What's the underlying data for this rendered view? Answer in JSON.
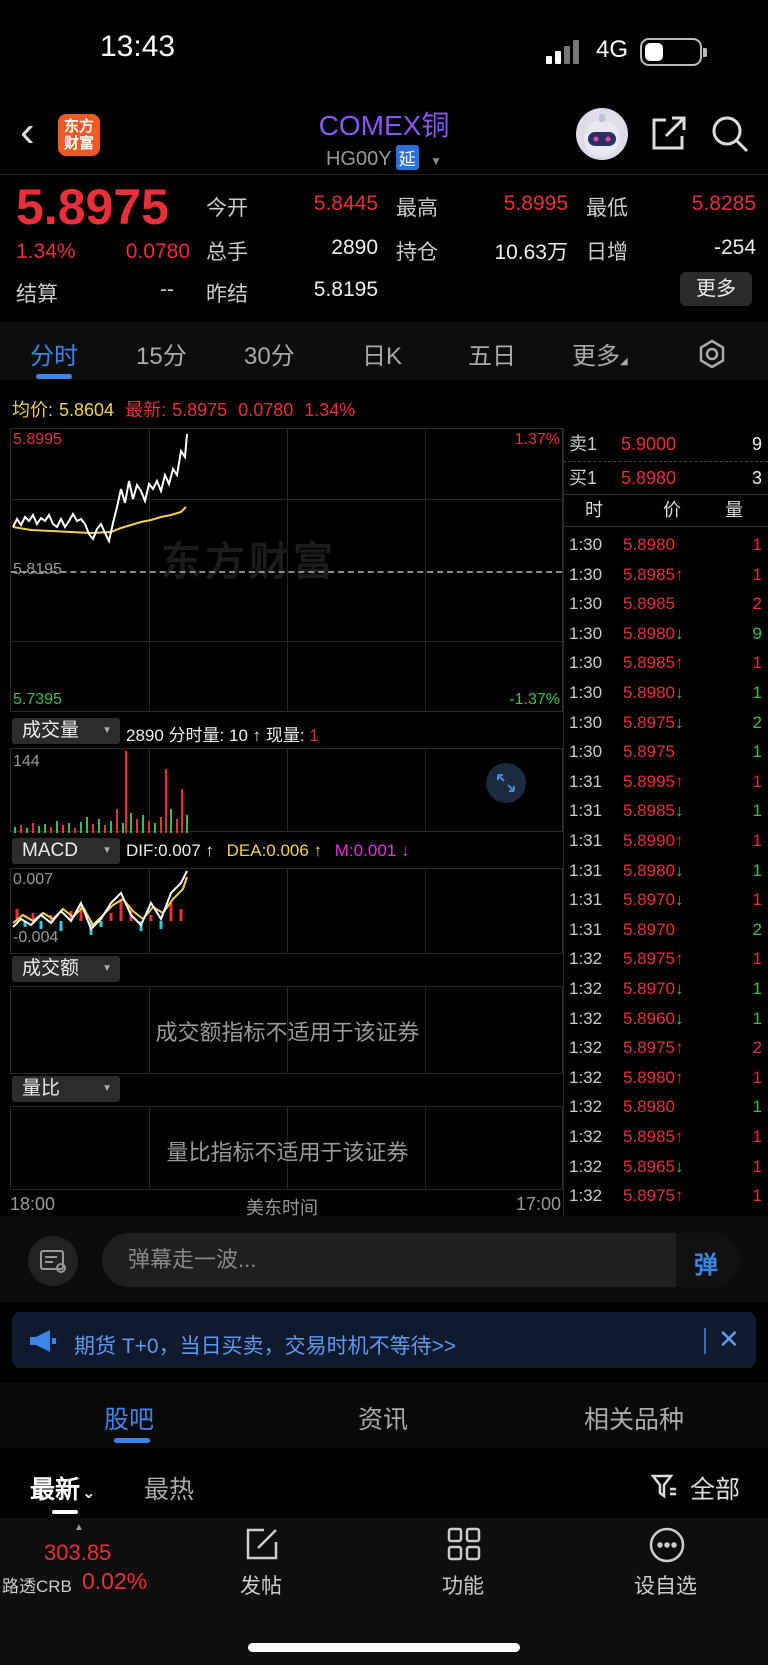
{
  "status_bar": {
    "time": "13:43",
    "network": "4G"
  },
  "header": {
    "logo_text": "东方财富",
    "title": "COMEX铜",
    "code": "HG00Y",
    "delay_badge": "延"
  },
  "quote": {
    "price": "5.8975",
    "change_pct": "1.34%",
    "change": "0.0780",
    "open_label": "今开",
    "open": "5.8445",
    "high_label": "最高",
    "high": "5.8995",
    "low_label": "最低",
    "low": "5.8285",
    "volume_label": "总手",
    "volume": "2890",
    "oi_label": "持仓",
    "oi": "10.63万",
    "daily_inc_label": "日增",
    "daily_inc": "-254",
    "settle_label": "结算",
    "settle": "--",
    "prev_settle_label": "昨结",
    "prev_settle": "5.8195",
    "more_label": "更多"
  },
  "tabs": [
    "分时",
    "15分",
    "30分",
    "日K",
    "五日",
    "更多"
  ],
  "intraday": {
    "avg_label": "均价:",
    "avg_value": "5.8604",
    "latest_label": "最新:",
    "latest_value": "5.8975",
    "latest_change": "0.0780",
    "latest_pct": "1.34%",
    "y_top": "5.8995",
    "y_mid": "5.8195",
    "y_bottom": "5.7395",
    "pct_top": "1.37%",
    "pct_bottom": "-1.37%",
    "watermark": "东方财富"
  },
  "volume_panel": {
    "chip": "成交量",
    "total": "2890",
    "minute_label": "分时量:",
    "minute_value": "10",
    "current_label": "现量:",
    "current_value": "1",
    "y_top": "144"
  },
  "macd_panel": {
    "chip": "MACD",
    "dif": "DIF:0.007",
    "dea": "DEA:0.006",
    "m": "M:0.001",
    "y_top": "0.007",
    "y_bottom": "-0.004"
  },
  "turnover_panel": {
    "chip": "成交额",
    "message": "成交额指标不适用于该证券"
  },
  "ratio_panel": {
    "chip": "量比",
    "message": "量比指标不适用于该证券"
  },
  "x_axis": {
    "start": "18:00",
    "middle": "美东时间",
    "end": "17:00"
  },
  "order_book": {
    "sell1_label": "卖1",
    "sell1_price": "5.9000",
    "sell1_qty": "9",
    "buy1_label": "买1",
    "buy1_price": "5.8980",
    "buy1_qty": "3",
    "header_time": "时",
    "header_price": "价",
    "header_qty": "量"
  },
  "ticks": [
    {
      "time": "1:30",
      "price": "5.8980",
      "arrow": "",
      "qty": "1",
      "qcolor": "red"
    },
    {
      "time": "1:30",
      "price": "5.8985",
      "arrow": "↑",
      "qty": "1",
      "qcolor": "red"
    },
    {
      "time": "1:30",
      "price": "5.8985",
      "arrow": "",
      "qty": "2",
      "qcolor": "red"
    },
    {
      "time": "1:30",
      "price": "5.8980",
      "arrow": "↓",
      "qty": "9",
      "qcolor": "green"
    },
    {
      "time": "1:30",
      "price": "5.8985",
      "arrow": "↑",
      "qty": "1",
      "qcolor": "red"
    },
    {
      "time": "1:30",
      "price": "5.8980",
      "arrow": "↓",
      "qty": "1",
      "qcolor": "green"
    },
    {
      "time": "1:30",
      "price": "5.8975",
      "arrow": "↓",
      "qty": "2",
      "qcolor": "green"
    },
    {
      "time": "1:30",
      "price": "5.8975",
      "arrow": "",
      "qty": "1",
      "qcolor": "green"
    },
    {
      "time": "1:31",
      "price": "5.8995",
      "arrow": "↑",
      "qty": "1",
      "qcolor": "red"
    },
    {
      "time": "1:31",
      "price": "5.8985",
      "arrow": "↓",
      "qty": "1",
      "qcolor": "green"
    },
    {
      "time": "1:31",
      "price": "5.8990",
      "arrow": "↑",
      "qty": "1",
      "qcolor": "red"
    },
    {
      "time": "1:31",
      "price": "5.8980",
      "arrow": "↓",
      "qty": "1",
      "qcolor": "green"
    },
    {
      "time": "1:31",
      "price": "5.8970",
      "arrow": "↓",
      "qty": "1",
      "qcolor": "red"
    },
    {
      "time": "1:31",
      "price": "5.8970",
      "arrow": "",
      "qty": "2",
      "qcolor": "green"
    },
    {
      "time": "1:32",
      "price": "5.8975",
      "arrow": "↑",
      "qty": "1",
      "qcolor": "red"
    },
    {
      "time": "1:32",
      "price": "5.8970",
      "arrow": "↓",
      "qty": "1",
      "qcolor": "green"
    },
    {
      "time": "1:32",
      "price": "5.8960",
      "arrow": "↓",
      "qty": "1",
      "qcolor": "green"
    },
    {
      "time": "1:32",
      "price": "5.8975",
      "arrow": "↑",
      "qty": "2",
      "qcolor": "red"
    },
    {
      "time": "1:32",
      "price": "5.8980",
      "arrow": "↑",
      "qty": "1",
      "qcolor": "red"
    },
    {
      "time": "1:32",
      "price": "5.8980",
      "arrow": "",
      "qty": "1",
      "qcolor": "green"
    },
    {
      "time": "1:32",
      "price": "5.8985",
      "arrow": "↑",
      "qty": "1",
      "qcolor": "red"
    },
    {
      "time": "1:32",
      "price": "5.8965",
      "arrow": "↓",
      "qty": "1",
      "qcolor": "red"
    },
    {
      "time": "1:32",
      "price": "5.8975",
      "arrow": "↑",
      "qty": "1",
      "qcolor": "red"
    }
  ],
  "danmaku": {
    "placeholder": "弹幕走一波...",
    "send_label": "弹"
  },
  "promo": {
    "text": "期货 T+0，当日买卖，交易时机不等待>>"
  },
  "sub_tabs": [
    "股吧",
    "资讯",
    "相关品种"
  ],
  "filters": {
    "latest": "最新",
    "hot": "最热",
    "all": "全部"
  },
  "bottom_nav": {
    "index_price": "303.85",
    "index_name": "路透CRB",
    "index_pct": "0.02%",
    "post": "发帖",
    "features": "功能",
    "watchlist": "设自选"
  },
  "colors": {
    "up": "#e8303a",
    "down": "#35c04f",
    "accent": "#3d86e8",
    "avg_line": "#f1d250",
    "title": "#8a57f5"
  }
}
